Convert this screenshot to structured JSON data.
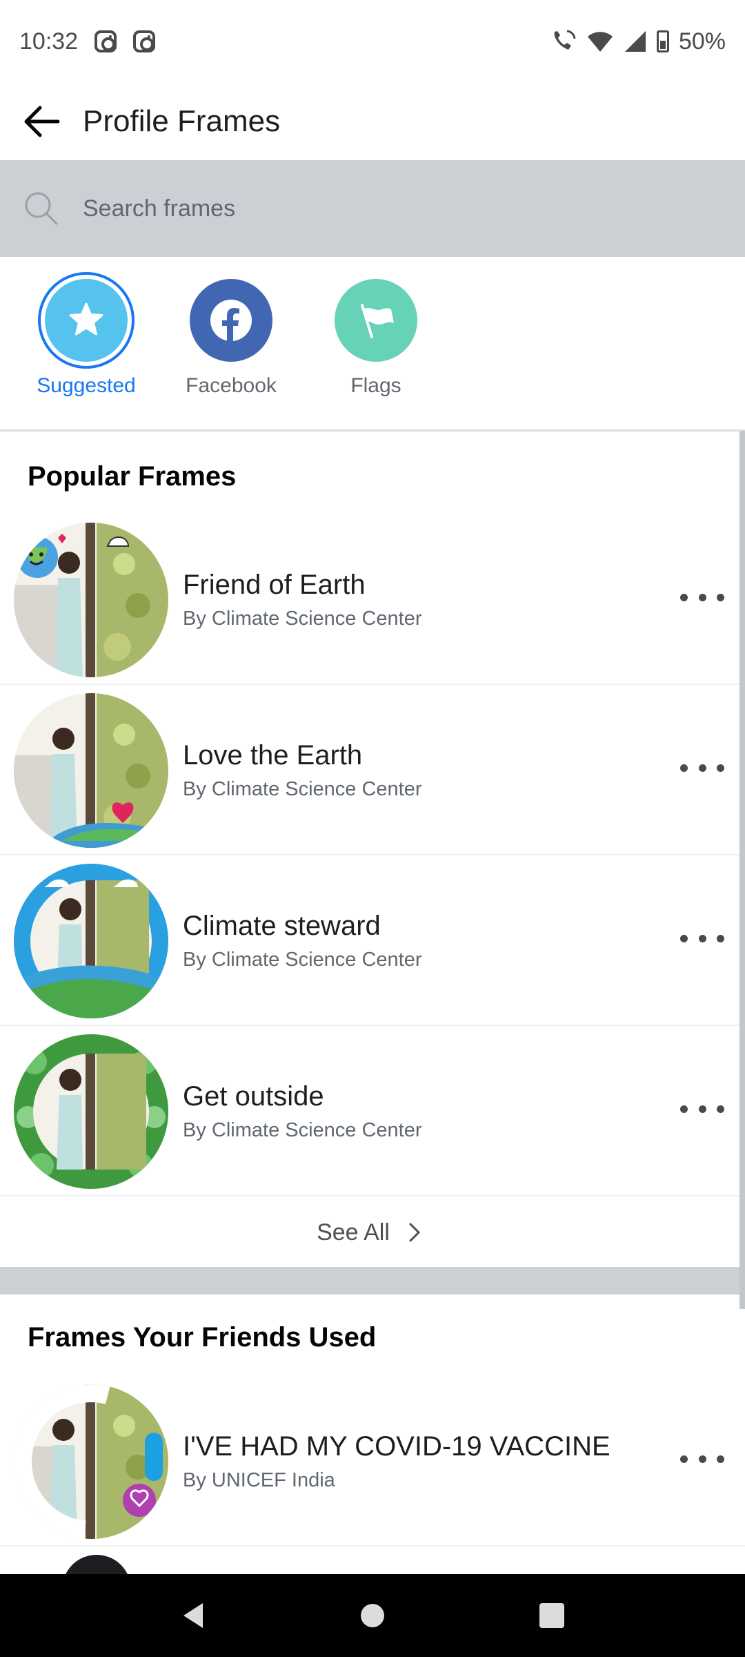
{
  "status_bar": {
    "time": "10:32",
    "battery": "50%"
  },
  "app_bar": {
    "title": "Profile Frames"
  },
  "search": {
    "placeholder": "Search frames"
  },
  "categories": [
    {
      "label": "Suggested",
      "color": "#56c3ef",
      "icon": "star-icon"
    },
    {
      "label": "Facebook",
      "color": "#4267b2",
      "icon": "facebook-icon"
    },
    {
      "label": "Flags",
      "color": "#66d2b8",
      "icon": "flag-icon"
    }
  ],
  "popular": {
    "title": "Popular Frames",
    "items": [
      {
        "title": "Friend of Earth",
        "subtitle": "By Climate Science Center"
      },
      {
        "title": "Love the Earth",
        "subtitle": "By Climate Science Center"
      },
      {
        "title": "Climate steward",
        "subtitle": "By Climate Science Center"
      },
      {
        "title": "Get outside",
        "subtitle": "By Climate Science Center"
      }
    ],
    "see_all": "See All"
  },
  "friends": {
    "title": "Frames Your Friends Used",
    "items": [
      {
        "title": "I'VE HAD MY COVID-19 VACCINE",
        "subtitle": "By UNICEF India"
      }
    ]
  },
  "colors": {
    "accent": "#1877f2",
    "band": "#ccd0d5"
  }
}
